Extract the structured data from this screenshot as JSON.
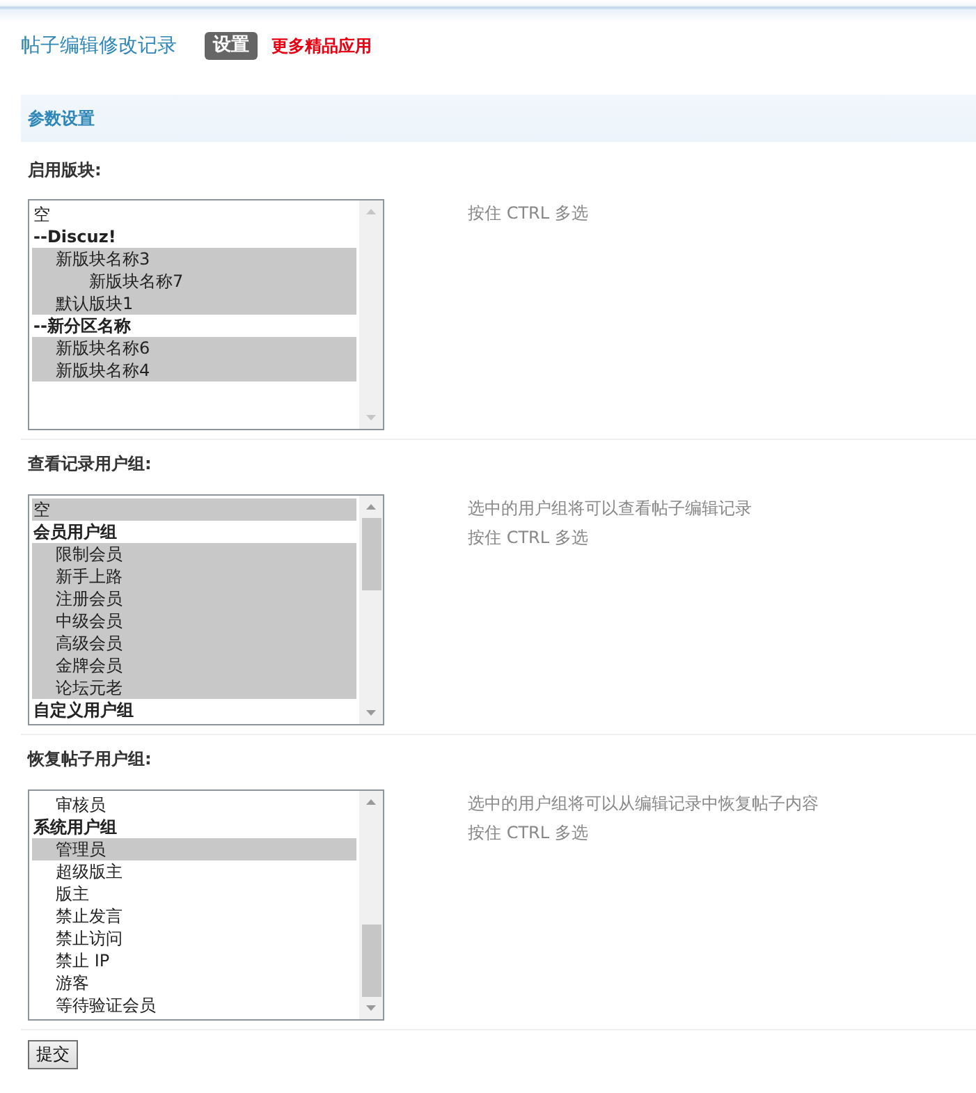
{
  "header": {
    "title": "帖子编辑修改记录",
    "tabs": [
      {
        "label": "设置",
        "selected": true
      }
    ],
    "link": "更多精品应用"
  },
  "section": {
    "title": "参数设置"
  },
  "settings": [
    {
      "label": "启用版块:",
      "options": [
        {
          "kind": "option",
          "text": "空",
          "selected": false
        },
        {
          "kind": "group",
          "text": "--Discuz!",
          "children": [
            {
              "kind": "option",
              "text": "新版块名称3",
              "selected": true,
              "children": [
                {
                  "kind": "option",
                  "text": "新版块名称7",
                  "selected": true
                }
              ]
            },
            {
              "kind": "option",
              "text": "默认版块1",
              "selected": true
            }
          ]
        },
        {
          "kind": "group",
          "text": "--新分区名称",
          "children": [
            {
              "kind": "option",
              "text": "新版块名称6",
              "selected": true
            },
            {
              "kind": "option",
              "text": "新版块名称4",
              "selected": true
            }
          ]
        }
      ],
      "hints": [
        "按住 CTRL 多选"
      ]
    },
    {
      "label": "查看记录用户组:",
      "options": [
        {
          "kind": "option",
          "text": "空",
          "selected": true
        },
        {
          "kind": "group",
          "text": "会员用户组",
          "children": [
            {
              "kind": "option",
              "text": "限制会员",
              "selected": true
            },
            {
              "kind": "option",
              "text": "新手上路",
              "selected": true
            },
            {
              "kind": "option",
              "text": "注册会员",
              "selected": true
            },
            {
              "kind": "option",
              "text": "中级会员",
              "selected": true
            },
            {
              "kind": "option",
              "text": "高级会员",
              "selected": true
            },
            {
              "kind": "option",
              "text": "金牌会员",
              "selected": true
            },
            {
              "kind": "option",
              "text": "论坛元老",
              "selected": true
            }
          ]
        },
        {
          "kind": "group",
          "text": "自定义用户组"
        }
      ],
      "hints": [
        "选中的用户组将可以查看帖子编辑记录",
        "按住 CTRL 多选"
      ]
    },
    {
      "label": "恢复帖子用户组:",
      "options": [
        {
          "kind": "group",
          "children": [
            {
              "kind": "option",
              "text": "审核员",
              "selected": false
            }
          ]
        },
        {
          "kind": "group",
          "text": "系统用户组",
          "children": [
            {
              "kind": "option",
              "text": "管理员",
              "selected": true
            },
            {
              "kind": "option",
              "text": "超级版主",
              "selected": false
            },
            {
              "kind": "option",
              "text": "版主",
              "selected": false
            },
            {
              "kind": "option",
              "text": "禁止发言",
              "selected": false
            },
            {
              "kind": "option",
              "text": "禁止访问",
              "selected": false
            },
            {
              "kind": "option",
              "text": "禁止 IP",
              "selected": false
            },
            {
              "kind": "option",
              "text": "游客",
              "selected": false
            },
            {
              "kind": "option",
              "text": "等待验证会员",
              "selected": false
            }
          ]
        }
      ],
      "hints": [
        "选中的用户组将可以从编辑记录中恢复帖子内容",
        "按住 CTRL 多选"
      ]
    }
  ],
  "submit": {
    "label": "提交"
  }
}
